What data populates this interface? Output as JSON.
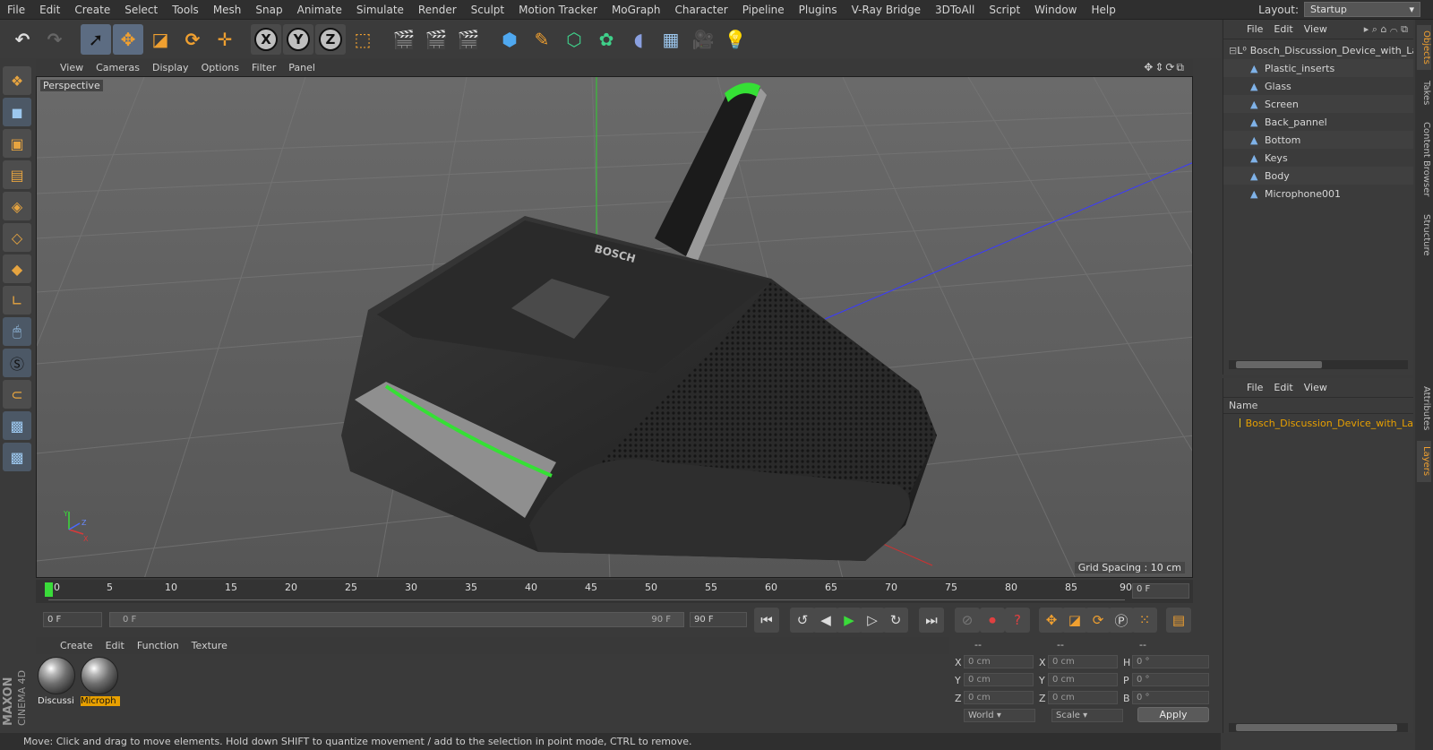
{
  "menubar": {
    "items": [
      "File",
      "Edit",
      "Create",
      "Select",
      "Tools",
      "Mesh",
      "Snap",
      "Animate",
      "Simulate",
      "Render",
      "Sculpt",
      "Motion Tracker",
      "MoGraph",
      "Character",
      "Pipeline",
      "Plugins",
      "V-Ray Bridge",
      "3DToAll",
      "Script",
      "Window",
      "Help"
    ],
    "layout_label": "Layout:",
    "layout_value": "Startup"
  },
  "toolbar": {
    "axis_x": "X",
    "axis_y": "Y",
    "axis_z": "Z"
  },
  "viewport": {
    "menu": [
      "View",
      "Cameras",
      "Display",
      "Options",
      "Filter",
      "Panel"
    ],
    "camera_label": "Perspective",
    "grid_spacing": "Grid Spacing : 10 cm",
    "axis_x": "X",
    "axis_y": "Y",
    "axis_z": "Z",
    "brand": "BOSCH"
  },
  "timeline": {
    "ticks": [
      "0",
      "5",
      "10",
      "15",
      "20",
      "25",
      "30",
      "35",
      "40",
      "45",
      "50",
      "55",
      "60",
      "65",
      "70",
      "75",
      "80",
      "85",
      "90"
    ],
    "current_frame": "0 F"
  },
  "transport": {
    "start_frame": "0 F",
    "range_start": "0 F",
    "range_end": "90 F",
    "end_frame": "90 F"
  },
  "material_manager": {
    "menu": [
      "Create",
      "Edit",
      "Function",
      "Texture"
    ],
    "materials": [
      {
        "name": "Discussi"
      },
      {
        "name": "Microph"
      }
    ]
  },
  "coordinates": {
    "header": [
      "--",
      "--",
      "--"
    ],
    "rows": [
      {
        "axis": "X",
        "pos": "0 cm",
        "size_axis": "X",
        "size": "0 cm",
        "rot_axis": "H",
        "rot": "0 °"
      },
      {
        "axis": "Y",
        "pos": "0 cm",
        "size_axis": "Y",
        "size": "0 cm",
        "rot_axis": "P",
        "rot": "0 °"
      },
      {
        "axis": "Z",
        "pos": "0 cm",
        "size_axis": "Z",
        "size": "0 cm",
        "rot_axis": "B",
        "rot": "0 °"
      }
    ],
    "mode_world": "World",
    "mode_scale": "Scale",
    "apply": "Apply"
  },
  "status": {
    "text": "Move: Click and drag to move elements. Hold down SHIFT to quantize movement / add to the selection in point mode, CTRL to remove."
  },
  "objects_panel": {
    "menu": [
      "File",
      "Edit",
      "View"
    ],
    "root": "Bosch_Discussion_Device_with_Lan",
    "children": [
      "Plastic_inserts",
      "Glass",
      "Screen",
      "Back_pannel",
      "Bottom",
      "Keys",
      "Body",
      "Microphone001"
    ]
  },
  "layers_panel": {
    "menu": [
      "File",
      "Edit",
      "View"
    ],
    "column_name": "Name",
    "item": "Bosch_Discussion_Device_with_La",
    "item_color": "#e8c31a"
  },
  "side_tabs": [
    "Objects",
    "Takes",
    "Content Browser",
    "Structure",
    "Attributes",
    "Layers"
  ],
  "logo": {
    "line1": "MAXON",
    "line2": "CINEMA 4D"
  },
  "colors": {
    "accent": "#3adb3a",
    "selection": "#e8a000"
  }
}
